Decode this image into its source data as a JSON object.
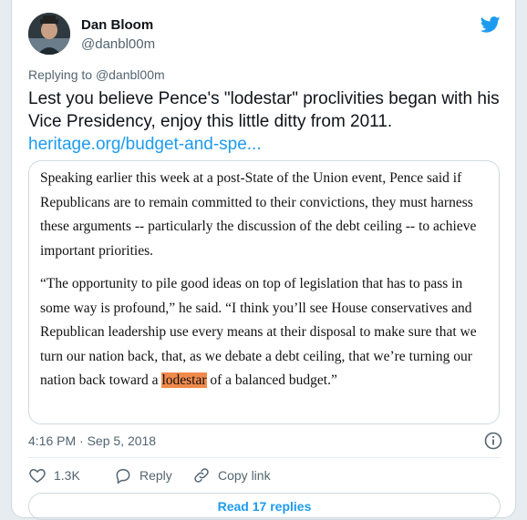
{
  "author": {
    "name": "Dan Bloom",
    "handle": "@danbl00m",
    "avatar_icon": "person-avatar"
  },
  "brand": {
    "icon": "twitter-bird-icon",
    "color": "#1d9bf0"
  },
  "replying": {
    "prefix": "Replying to",
    "handle": "@danbl00m"
  },
  "tweet": {
    "text": "Lest you believe Pence's \"lodestar\" proclivities began with his Vice Presidency, enjoy this little ditty from 2011.",
    "link": "heritage.org/budget-and-spe..."
  },
  "quote": {
    "para1": "Speaking earlier this week at a post-State of the Union event, Pence said if Republicans are to remain committed to their convictions, they must harness these arguments -- particularly the discussion of the debt ceiling -- to achieve important priorities.",
    "para2_before": "“The opportunity to pile good ideas on top of legislation that has to pass in some way is profound,” he said. “I think you’ll see House conservatives and Republican leadership use every means at their disposal to make sure that we turn our nation back, that, as we debate a debt ceiling, that we’re turning our nation back toward a ",
    "para2_highlight": "lodestar",
    "para2_after": " of a balanced budget.”",
    "highlight_color": "#f08a4b"
  },
  "meta": {
    "timestamp": "4:16 PM · Sep 5, 2018"
  },
  "actions": {
    "likes": "1.3K",
    "reply_label": "Reply",
    "copy_label": "Copy link"
  },
  "read_replies": "Read 17 replies"
}
